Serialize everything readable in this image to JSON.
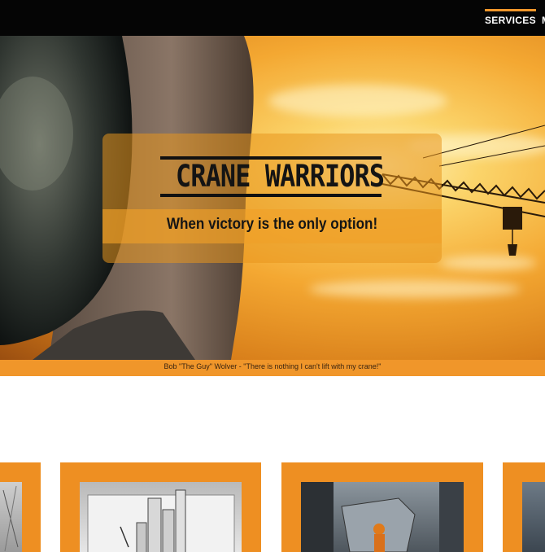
{
  "nav": {
    "items": [
      {
        "label": "SERVICES",
        "active": true
      },
      {
        "label": "",
        "active": false
      }
    ],
    "accent": "#f0962a"
  },
  "hero": {
    "title": "CRANE WARRIORS",
    "tagline": "When victory is the only option!",
    "quote": "Bob \"The Guy\" Wolver - \"There is nothing I can't lift with my crane!\""
  },
  "cards": [
    {
      "image": "building-photo"
    },
    {
      "image": "construction-model-photo"
    },
    {
      "image": "worker-lifting-container-photo"
    },
    {
      "image": "tower-photo"
    }
  ],
  "colors": {
    "nav_bg": "#050505",
    "accent": "#f0962a",
    "card_bg": "#ee8f22"
  }
}
